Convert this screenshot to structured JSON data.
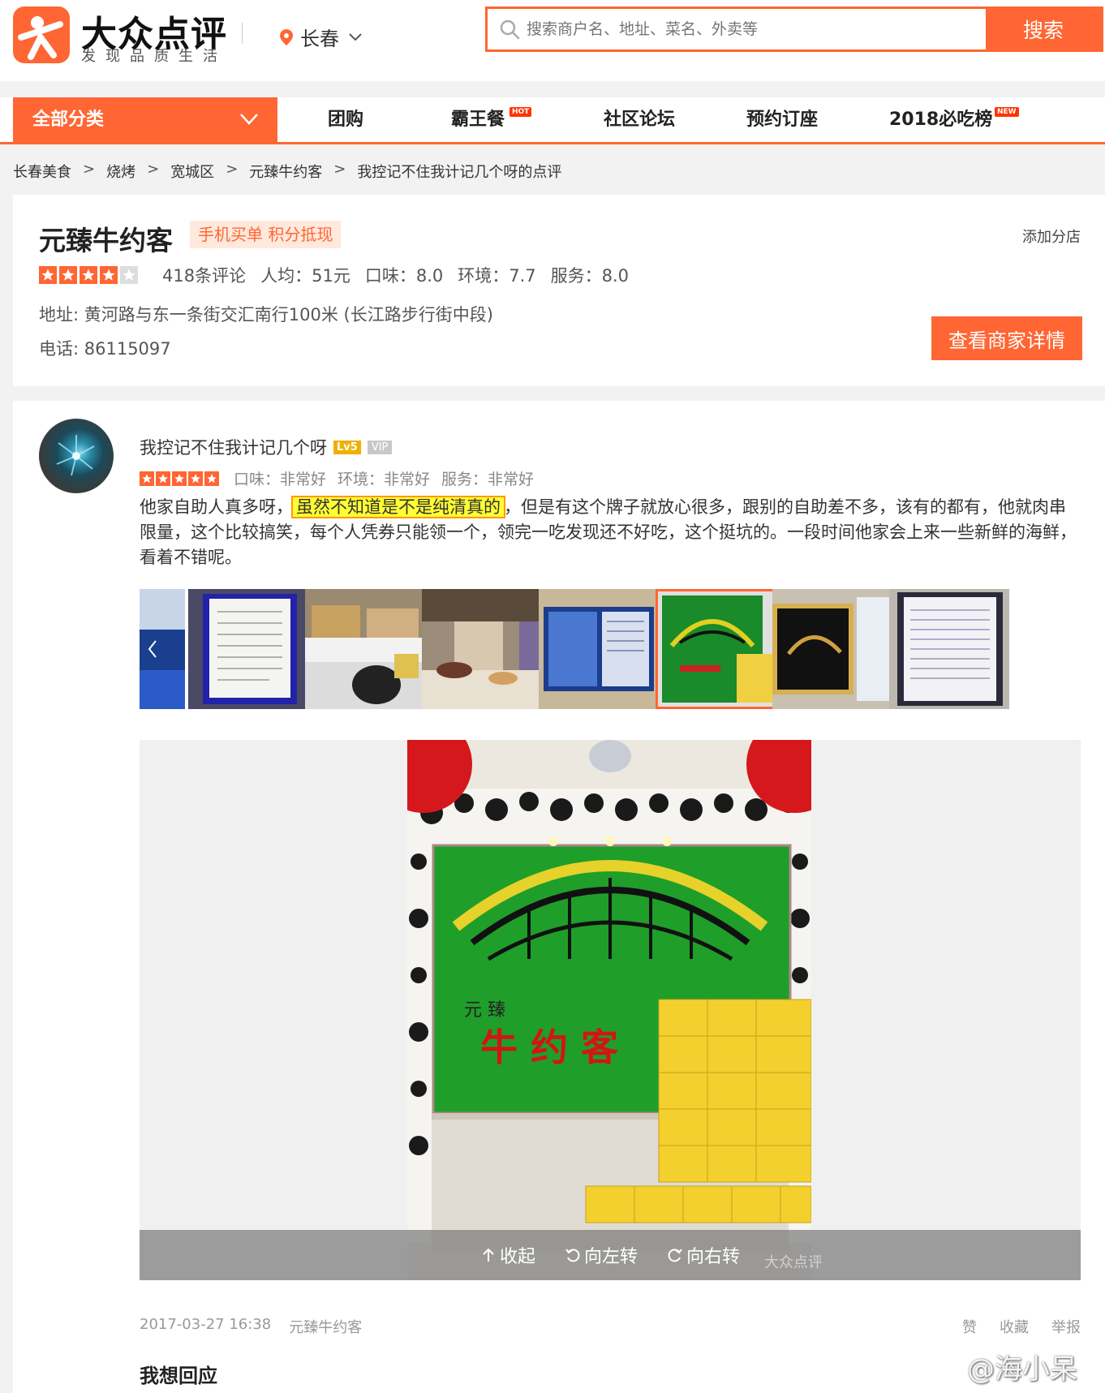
{
  "header": {
    "logo_title": "大众点评",
    "logo_subtitle": "发现品质生活",
    "city": "长春",
    "search_placeholder": "搜索商户名、地址、菜名、外卖等",
    "search_button": "搜索",
    "brand_color": "#ff6633"
  },
  "nav": {
    "all_categories": "全部分类",
    "items": [
      {
        "label": "团购",
        "badge": ""
      },
      {
        "label": "霸王餐",
        "badge": "HOT"
      },
      {
        "label": "社区论坛",
        "badge": ""
      },
      {
        "label": "预约订座",
        "badge": ""
      },
      {
        "label": "2018必吃榜",
        "badge": "NEW"
      }
    ]
  },
  "breadcrumb": [
    "长春美食",
    "烧烤",
    "宽城区",
    "元臻牛约客",
    "我控记不住我计记几个呀的点评"
  ],
  "shop": {
    "name": "元臻牛约客",
    "tag": "手机买单 积分抵现",
    "add_branch": "添加分店",
    "rating_stars": 4,
    "review_count": "418条评论",
    "avg_price": "人均：51元",
    "taste": "口味：8.0",
    "environment": "环境：7.7",
    "service": "服务：8.0",
    "address": "地址: 黄河路与东一条街交汇南行100米 (长江路步行街中段)",
    "phone": "电话: 86115097",
    "detail_button": "查看商家详情"
  },
  "review": {
    "user": "我控记不住我计记几个呀",
    "level": "Lv5",
    "vip": "VIP",
    "stars": 5,
    "taste": "口味：非常好",
    "environment": "环境：非常好",
    "service": "服务：非常好",
    "text_before": "他家自助人真多呀，",
    "text_highlight": "虽然不知道是不是纯清真的",
    "text_after": "，但是有这个牌子就放心很多，跟别的自助差不多，该有的都有，他就肉串限量，这个比较搞笑，每个人凭券只能领一个，领完一吃发现还不好吃，这个挺坑的。一段时间他家会上来一些新鲜的海鲜，看着不错呢。",
    "photo_count": 8,
    "active_photo_index": 5,
    "toolbar": {
      "collapse": "收起",
      "rotate_left": "向左转",
      "rotate_right": "向右转"
    },
    "photo_watermark": "大众点评",
    "photo_sign_small": "元 臻",
    "photo_sign_big": "牛 约 客",
    "datetime": "2017-03-27 16:38",
    "shop": "元臻牛约客",
    "actions": [
      "赞",
      "收藏",
      "举报"
    ],
    "reply_title": "我想回应"
  },
  "watermark": "@海小呆"
}
